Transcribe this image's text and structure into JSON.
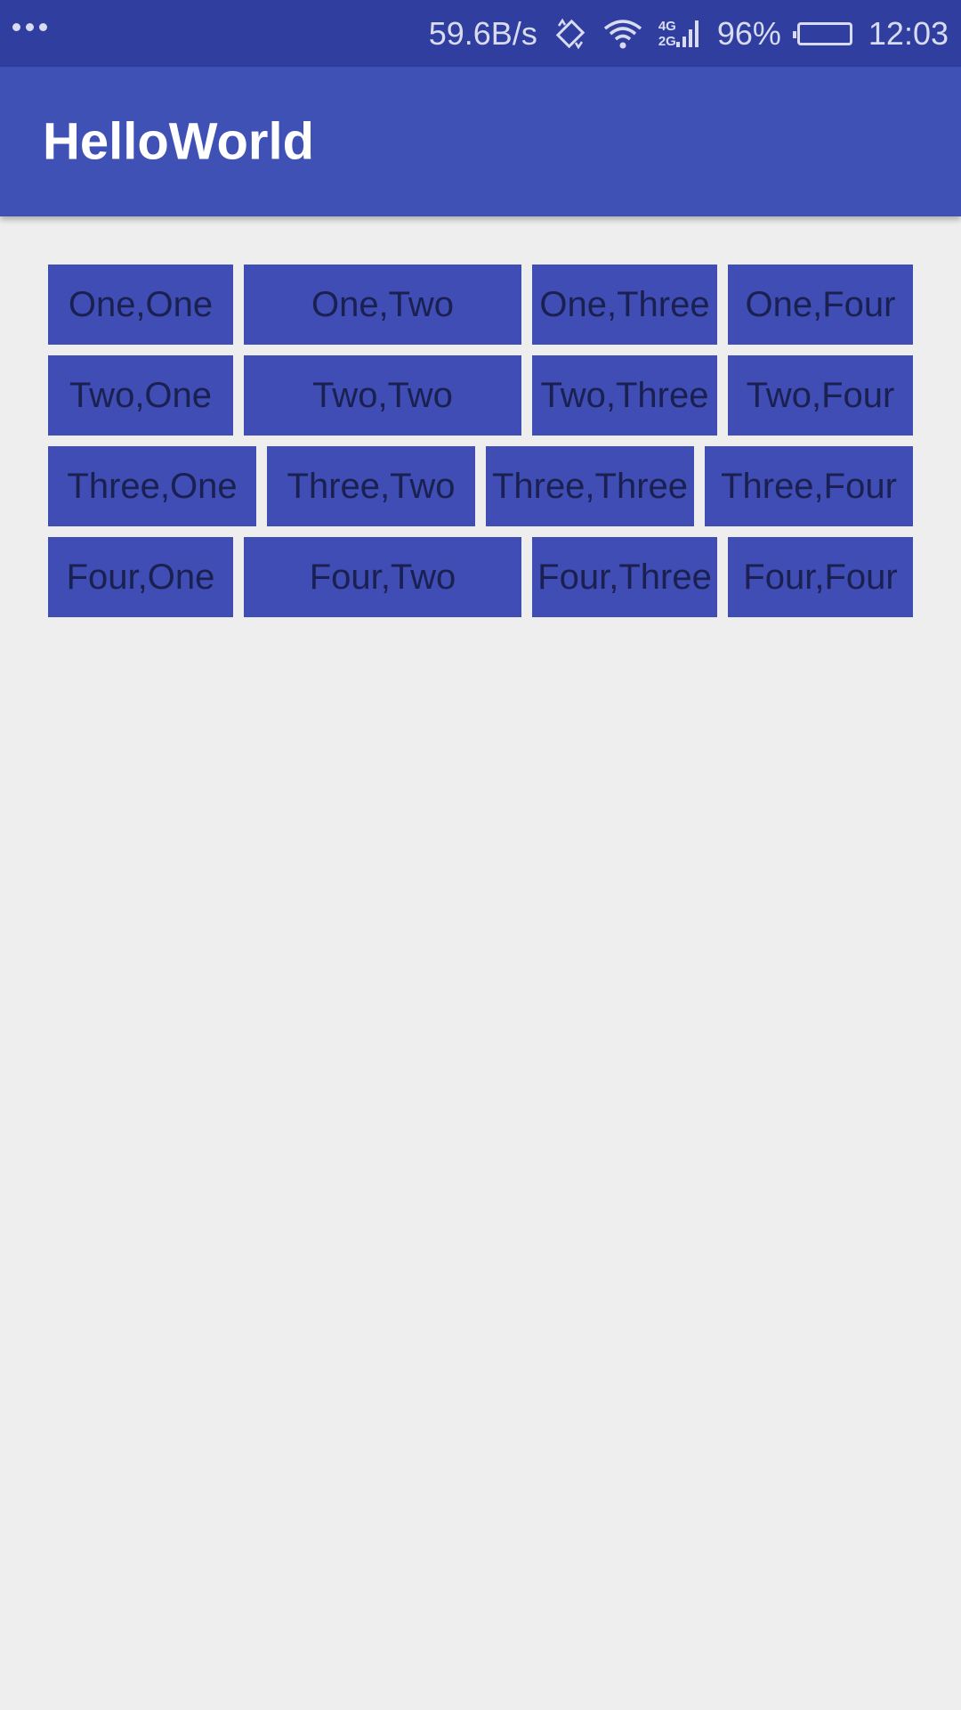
{
  "status_bar": {
    "network_speed": "59.6B/s",
    "battery_percent": "96%",
    "time": "12:03",
    "net_top": "4G",
    "net_bottom": "2G",
    "battery_level": 0.96,
    "icons": [
      "more-dots-icon",
      "rotate-icon",
      "wifi-icon",
      "signal-icon",
      "battery-icon"
    ]
  },
  "app_bar": {
    "title": "HelloWorld",
    "color": "#3f51b5"
  },
  "grid": {
    "rows": [
      {
        "cells": [
          "One,One",
          "One,Two",
          "One,Three",
          "One,Four"
        ]
      },
      {
        "cells": [
          "Two,One",
          "Two,Two",
          "Two,Three",
          "Two,Four"
        ]
      },
      {
        "cells": [
          "Three,One",
          "Three,Two",
          "Three,Three",
          "Three,Four"
        ]
      },
      {
        "cells": [
          "Four,One",
          "Four,Two",
          "Four,Three",
          "Four,Four"
        ]
      }
    ]
  }
}
